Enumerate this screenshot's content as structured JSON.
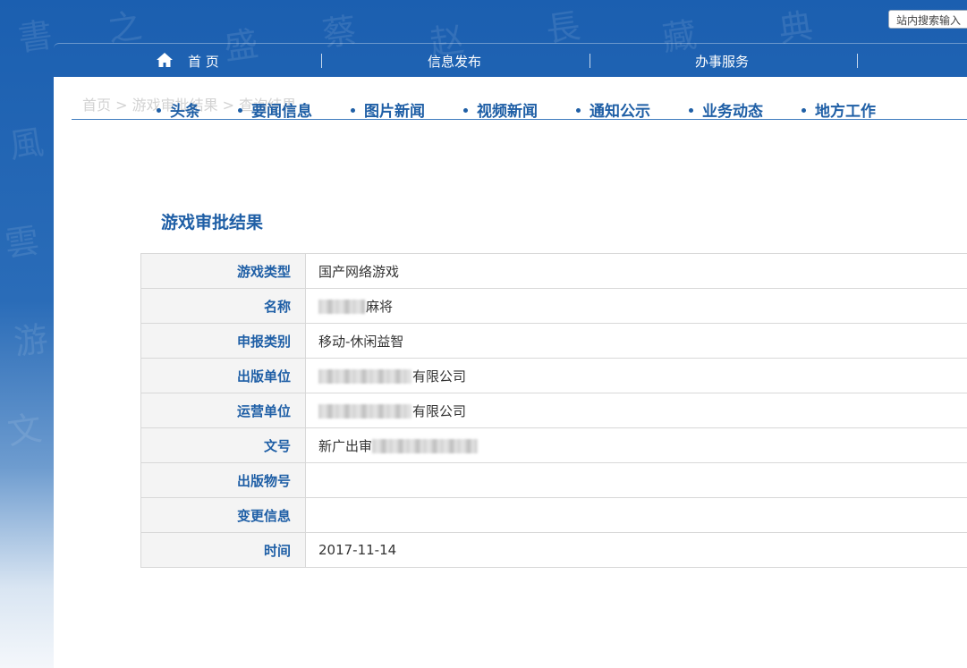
{
  "search": {
    "placeholder": "站内搜索输入"
  },
  "nav": {
    "items": [
      {
        "label": "首 页"
      },
      {
        "label": "信息发布"
      },
      {
        "label": "办事服务"
      }
    ]
  },
  "breadcrumb": {
    "text": "首页 > 游戏审批结果 > 查询结果"
  },
  "subnav": {
    "items": [
      {
        "label": "头条"
      },
      {
        "label": "要闻信息"
      },
      {
        "label": "图片新闻"
      },
      {
        "label": "视频新闻"
      },
      {
        "label": "通知公示"
      },
      {
        "label": "业务动态"
      },
      {
        "label": "地方工作"
      }
    ]
  },
  "page_title": "游戏审批结果",
  "table": {
    "rows": [
      {
        "label": "游戏类型",
        "value": "国产网络游戏"
      },
      {
        "label": "名称",
        "value": "麻将"
      },
      {
        "label": "申报类别",
        "value": "移动-休闲益智"
      },
      {
        "label": "出版单位",
        "value": "有限公司"
      },
      {
        "label": "运营单位",
        "value": "有限公司"
      },
      {
        "label": "文号",
        "value": "新广出审"
      },
      {
        "label": "出版物号",
        "value": ""
      },
      {
        "label": "变更信息",
        "value": ""
      },
      {
        "label": "时间",
        "value": "2017-11-14"
      }
    ]
  },
  "colors": {
    "brand_blue": "#1f5fa6",
    "header_blue": "#1b5fb0"
  }
}
